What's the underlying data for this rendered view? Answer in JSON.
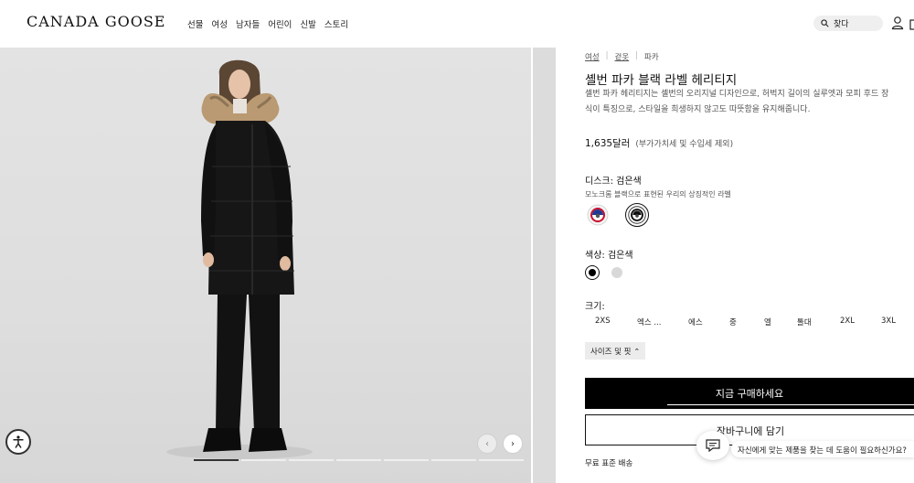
{
  "header": {
    "logo": "CANADA GOOSE",
    "nav": [
      "선물",
      "여성",
      "남자들",
      "어린이",
      "신발",
      "스토리"
    ],
    "search_label": "찾다"
  },
  "gallery": {
    "slide_count": 7,
    "active_slide": 1
  },
  "product": {
    "breadcrumbs": [
      "여성",
      "겉옷",
      "파카"
    ],
    "title": "셸번 파카 블랙 라벨 헤리티지",
    "description": "셸번 파카 헤리티지는 셸번의 오리지널 디자인으로, 허벅지 길이의 실루엣과 모피 후드 장식이 특징으로, 스타일을 희생하지 않고도 따뜻함을 유지해줍니다.",
    "price": "1,635달러",
    "price_note": "(부가가치세 및 수입세 제외)",
    "disc_label": "디스크: 검은색",
    "disc_sub": "모노크롬 블랙으로 표현된 우리의 상징적인 라벨",
    "color_label": "색상: 검은색",
    "colors": [
      "#000000",
      "#d8d8d8"
    ],
    "size_label": "크기:",
    "sizes": [
      "2XS",
      "엑스 ...",
      "에스",
      "중",
      "엘",
      "톨대",
      "2XL",
      "3XL"
    ],
    "size_guide": "사이즈 및 핏 ⁠⌃",
    "buy_now": "지금 구매하세요",
    "add_to_cart": "장바구니에 담기",
    "shipping": "무료 표준 배송"
  },
  "chat": {
    "prompt": "자신에게 맞는 제품을 찾는 데 도움이 필요하신가요?"
  }
}
